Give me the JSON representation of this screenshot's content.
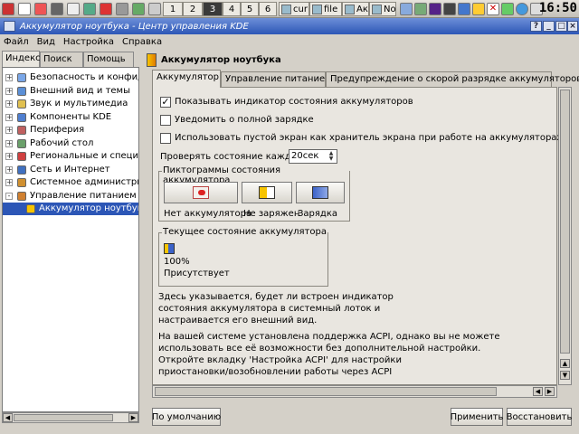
{
  "panel": {
    "desktops": [
      "1",
      "2",
      "3",
      "4",
      "5",
      "6"
    ],
    "tasks": [
      {
        "label": "cur"
      },
      {
        "label": "file"
      },
      {
        "label": "Акс"
      },
      {
        "label": "No"
      }
    ],
    "clock": "16:50"
  },
  "window": {
    "title": "Аккумулятор ноутбука - Центр управления KDE",
    "help_button": "?",
    "minimize_button": "_",
    "maximize_button": "□",
    "close_button": "×"
  },
  "menubar": [
    "Файл",
    "Вид",
    "Настройка",
    "Справка"
  ],
  "left_tabs": [
    "Индекс",
    "Поиск",
    "Помощь"
  ],
  "tree": [
    {
      "label": "Безопасность и конфиденц",
      "expander": "+",
      "color": "#7aa7e8"
    },
    {
      "label": "Внешний вид и темы",
      "expander": "+",
      "color": "#5b8fd6"
    },
    {
      "label": "Звук и мультимедиа",
      "expander": "+",
      "color": "#e0c050"
    },
    {
      "label": "Компоненты KDE",
      "expander": "+",
      "color": "#4f7fd0"
    },
    {
      "label": "Периферия",
      "expander": "+",
      "color": "#c06060"
    },
    {
      "label": "Рабочий стол",
      "expander": "+",
      "color": "#6aa06a"
    },
    {
      "label": "Региональные и специальн",
      "expander": "+",
      "color": "#d04040"
    },
    {
      "label": "Сеть и Интернет",
      "expander": "+",
      "color": "#4070c0"
    },
    {
      "label": "Системное администриров",
      "expander": "+",
      "color": "#d09030"
    },
    {
      "label": "Управление питанием",
      "expander": "-",
      "color": "#d08030"
    },
    {
      "label": "Аккумулятор ноутбука",
      "expander": "",
      "color": "#f7c400",
      "selected": true
    }
  ],
  "module_title": "Аккумулятор ноутбука",
  "tabs": [
    "Аккумулятор",
    "Управление питанием",
    "Предупреждение о скорой разрядке аккумуляторов"
  ],
  "options": {
    "show_indicator": "Показывать индикатор состояния аккумуляторов",
    "notify_full": "Уведомить о полной зарядке",
    "blank_screen": "Использовать пустой экран как хранитель экрана при работе на аккумуляторах",
    "check_label": "Проверять состояние каждые:",
    "check_value": "20сек"
  },
  "icons_group": {
    "title": "Пиктограммы состояния аккумулятора",
    "labels": [
      "Нет аккумулятора",
      "Не заряжен",
      "Зарядка"
    ]
  },
  "current_group": {
    "title": "Текущее состояние аккумулятора",
    "percent": "100%",
    "status": "Присутствует"
  },
  "description": [
    "Здесь указывается, будет ли встроен индикатор",
    "состояния аккумулятора в системный лоток и",
    "настраивается его внешний вид.",
    "На вашей системе установлена поддержка ACPI, однако вы не можете",
    "использовать все её возможности без дополнительной настройки.",
    "Откройте вкладку 'Настройка ACPI' для настройки",
    "приостановки/возобновлении работы через ACPI"
  ],
  "buttons": {
    "defaults": "По умолчанию",
    "apply": "Применить",
    "reset": "Восстановить"
  },
  "colors": {
    "titlebar": "#2c56b6",
    "selection": "#2c56b6",
    "battery_yellow": "#f7c400"
  }
}
